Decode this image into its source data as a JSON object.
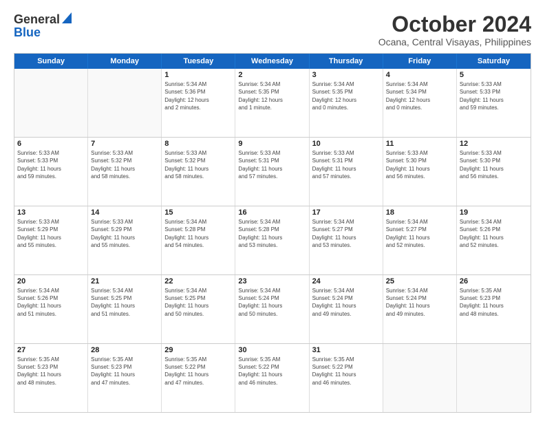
{
  "logo": {
    "line1": "General",
    "line2": "Blue"
  },
  "title": "October 2024",
  "subtitle": "Ocana, Central Visayas, Philippines",
  "days": [
    "Sunday",
    "Monday",
    "Tuesday",
    "Wednesday",
    "Thursday",
    "Friday",
    "Saturday"
  ],
  "weeks": [
    [
      {
        "num": "",
        "info": ""
      },
      {
        "num": "",
        "info": ""
      },
      {
        "num": "1",
        "info": "Sunrise: 5:34 AM\nSunset: 5:36 PM\nDaylight: 12 hours\nand 2 minutes."
      },
      {
        "num": "2",
        "info": "Sunrise: 5:34 AM\nSunset: 5:35 PM\nDaylight: 12 hours\nand 1 minute."
      },
      {
        "num": "3",
        "info": "Sunrise: 5:34 AM\nSunset: 5:35 PM\nDaylight: 12 hours\nand 0 minutes."
      },
      {
        "num": "4",
        "info": "Sunrise: 5:34 AM\nSunset: 5:34 PM\nDaylight: 12 hours\nand 0 minutes."
      },
      {
        "num": "5",
        "info": "Sunrise: 5:33 AM\nSunset: 5:33 PM\nDaylight: 11 hours\nand 59 minutes."
      }
    ],
    [
      {
        "num": "6",
        "info": "Sunrise: 5:33 AM\nSunset: 5:33 PM\nDaylight: 11 hours\nand 59 minutes."
      },
      {
        "num": "7",
        "info": "Sunrise: 5:33 AM\nSunset: 5:32 PM\nDaylight: 11 hours\nand 58 minutes."
      },
      {
        "num": "8",
        "info": "Sunrise: 5:33 AM\nSunset: 5:32 PM\nDaylight: 11 hours\nand 58 minutes."
      },
      {
        "num": "9",
        "info": "Sunrise: 5:33 AM\nSunset: 5:31 PM\nDaylight: 11 hours\nand 57 minutes."
      },
      {
        "num": "10",
        "info": "Sunrise: 5:33 AM\nSunset: 5:31 PM\nDaylight: 11 hours\nand 57 minutes."
      },
      {
        "num": "11",
        "info": "Sunrise: 5:33 AM\nSunset: 5:30 PM\nDaylight: 11 hours\nand 56 minutes."
      },
      {
        "num": "12",
        "info": "Sunrise: 5:33 AM\nSunset: 5:30 PM\nDaylight: 11 hours\nand 56 minutes."
      }
    ],
    [
      {
        "num": "13",
        "info": "Sunrise: 5:33 AM\nSunset: 5:29 PM\nDaylight: 11 hours\nand 55 minutes."
      },
      {
        "num": "14",
        "info": "Sunrise: 5:33 AM\nSunset: 5:29 PM\nDaylight: 11 hours\nand 55 minutes."
      },
      {
        "num": "15",
        "info": "Sunrise: 5:34 AM\nSunset: 5:28 PM\nDaylight: 11 hours\nand 54 minutes."
      },
      {
        "num": "16",
        "info": "Sunrise: 5:34 AM\nSunset: 5:28 PM\nDaylight: 11 hours\nand 53 minutes."
      },
      {
        "num": "17",
        "info": "Sunrise: 5:34 AM\nSunset: 5:27 PM\nDaylight: 11 hours\nand 53 minutes."
      },
      {
        "num": "18",
        "info": "Sunrise: 5:34 AM\nSunset: 5:27 PM\nDaylight: 11 hours\nand 52 minutes."
      },
      {
        "num": "19",
        "info": "Sunrise: 5:34 AM\nSunset: 5:26 PM\nDaylight: 11 hours\nand 52 minutes."
      }
    ],
    [
      {
        "num": "20",
        "info": "Sunrise: 5:34 AM\nSunset: 5:26 PM\nDaylight: 11 hours\nand 51 minutes."
      },
      {
        "num": "21",
        "info": "Sunrise: 5:34 AM\nSunset: 5:25 PM\nDaylight: 11 hours\nand 51 minutes."
      },
      {
        "num": "22",
        "info": "Sunrise: 5:34 AM\nSunset: 5:25 PM\nDaylight: 11 hours\nand 50 minutes."
      },
      {
        "num": "23",
        "info": "Sunrise: 5:34 AM\nSunset: 5:24 PM\nDaylight: 11 hours\nand 50 minutes."
      },
      {
        "num": "24",
        "info": "Sunrise: 5:34 AM\nSunset: 5:24 PM\nDaylight: 11 hours\nand 49 minutes."
      },
      {
        "num": "25",
        "info": "Sunrise: 5:34 AM\nSunset: 5:24 PM\nDaylight: 11 hours\nand 49 minutes."
      },
      {
        "num": "26",
        "info": "Sunrise: 5:35 AM\nSunset: 5:23 PM\nDaylight: 11 hours\nand 48 minutes."
      }
    ],
    [
      {
        "num": "27",
        "info": "Sunrise: 5:35 AM\nSunset: 5:23 PM\nDaylight: 11 hours\nand 48 minutes."
      },
      {
        "num": "28",
        "info": "Sunrise: 5:35 AM\nSunset: 5:23 PM\nDaylight: 11 hours\nand 47 minutes."
      },
      {
        "num": "29",
        "info": "Sunrise: 5:35 AM\nSunset: 5:22 PM\nDaylight: 11 hours\nand 47 minutes."
      },
      {
        "num": "30",
        "info": "Sunrise: 5:35 AM\nSunset: 5:22 PM\nDaylight: 11 hours\nand 46 minutes."
      },
      {
        "num": "31",
        "info": "Sunrise: 5:35 AM\nSunset: 5:22 PM\nDaylight: 11 hours\nand 46 minutes."
      },
      {
        "num": "",
        "info": ""
      },
      {
        "num": "",
        "info": ""
      }
    ]
  ]
}
